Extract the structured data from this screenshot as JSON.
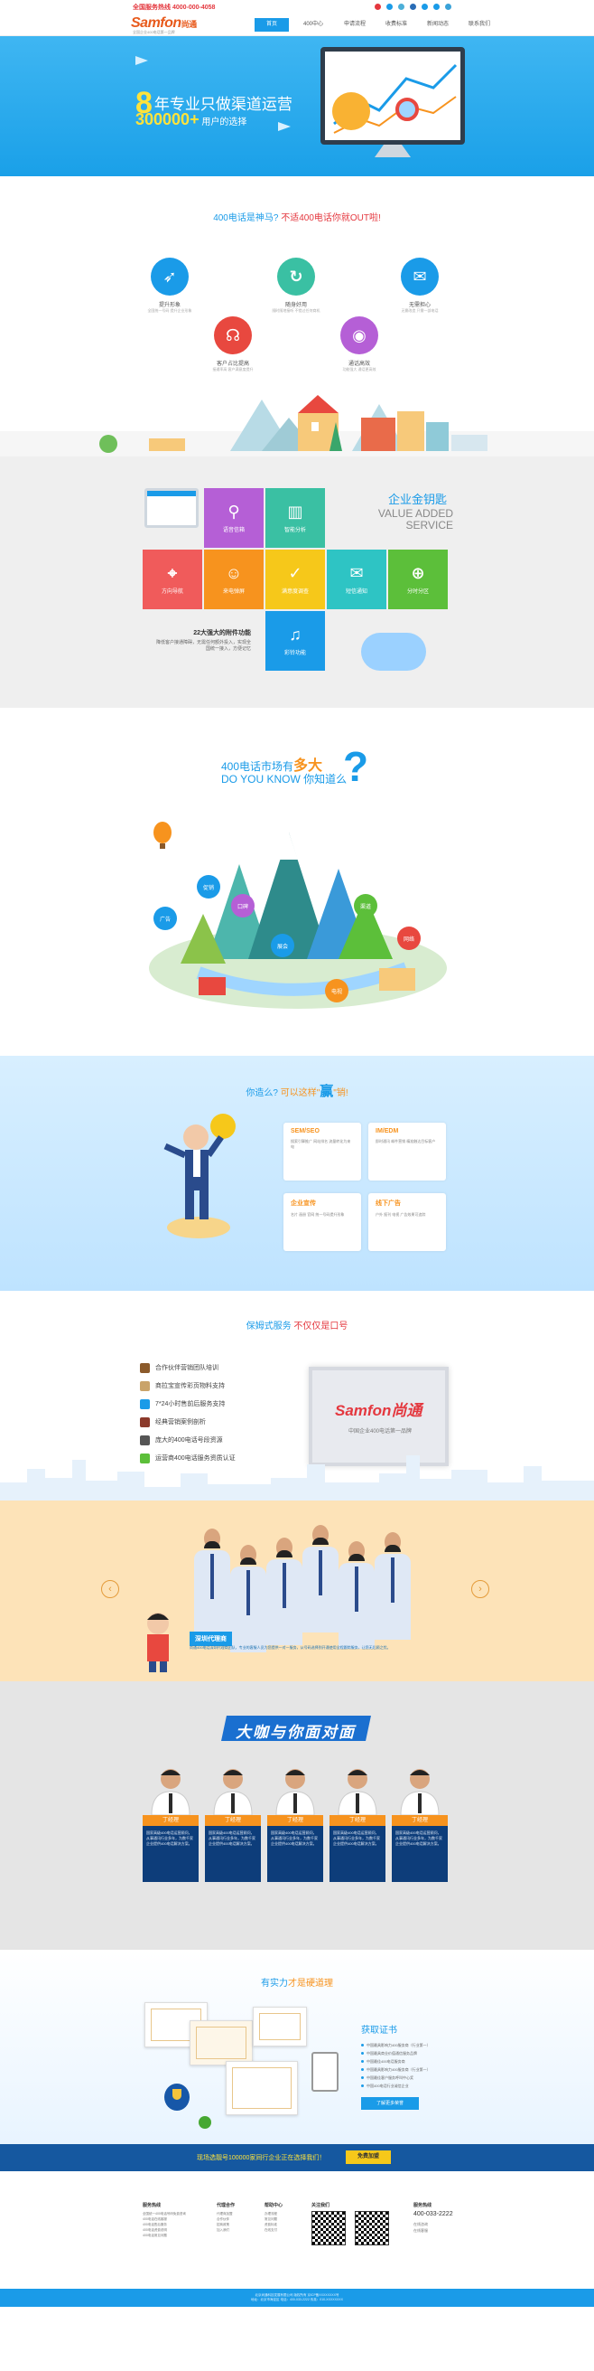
{
  "topbar": {
    "hotline": "全国服务热线 4000-000-4058",
    "logo": "Samfon",
    "logo_cn": "尚通",
    "logo_sub": "全国企业400电话第一品牌",
    "nav": [
      "首页",
      "400中心",
      "申请流程",
      "收费标准",
      "新闻动态",
      "联系我们"
    ]
  },
  "hero": {
    "num": "8",
    "title": "年专业只做渠道运营",
    "count": "300000+",
    "count_suffix": "用户的选择"
  },
  "s400": {
    "title_a": "400电话是神马?",
    "title_b": "不适400电话你就OUT啦!",
    "features": [
      {
        "name": "提升形象",
        "desc": "全国统一号码 提升企业形象"
      },
      {
        "name": "随身好用",
        "desc": "随时随地接听 不错过任何商机"
      },
      {
        "name": "无需担心",
        "desc": "无需改造 只需一部电话"
      },
      {
        "name": "客户占比提高",
        "desc": "接通率高 客户满意度提升"
      },
      {
        "name": "通话高效",
        "desc": "功能强大 通话更高效"
      }
    ]
  },
  "gold": {
    "title": "企业金钥匙",
    "en1": "VALUE ADDED",
    "en2": "SERVICE",
    "left_title": "22大强大的附件功能",
    "left_desc": "降低客户接通障碍，无需任何额外投入，实现全国统一接入，方便记忆",
    "tiles": [
      {
        "label": "语音信箱",
        "icon": "mic-icon",
        "color": "#b55fd6"
      },
      {
        "label": "智能分析",
        "icon": "chart-icon",
        "color": "#3ac0a3"
      },
      {
        "label": "方向导航",
        "icon": "pin-icon",
        "color": "#f05b5b"
      },
      {
        "label": "来电弹屏",
        "icon": "user-icon",
        "color": "#f7931e"
      },
      {
        "label": "满意度调查",
        "icon": "check-icon",
        "color": "#f6c81a"
      },
      {
        "label": "短信通知",
        "icon": "mail-icon",
        "color": "#2ec4c4"
      },
      {
        "label": "分时分区",
        "icon": "globe-icon",
        "color": "#5cbf3a"
      },
      {
        "label": "彩铃功能",
        "icon": "note-icon",
        "color": "#1a9be8"
      }
    ]
  },
  "know": {
    "title_a": "400电话市场有",
    "title_b": "多大",
    "en": "DO YOU KNOW 你知道么",
    "tags": [
      "广告",
      "促销",
      "口碑",
      "展会",
      "渠道",
      "网络",
      "电视"
    ]
  },
  "win": {
    "title_a": "你造么?",
    "title_b": "可以这样\"",
    "title_c": "赢",
    "title_d": "\"销!",
    "cards": [
      {
        "title": "SEM/SEO",
        "desc": "搜索引擎推广 网站排名 流量转化为来电"
      },
      {
        "title": "IM/EDM",
        "desc": "即时通讯 邮件营销 精准触达目标客户"
      },
      {
        "title": "企业宣传",
        "desc": "名片 画册 官网 统一号码提升形象"
      },
      {
        "title": "线下广告",
        "desc": "户外 报刊 电视 广告效果可追踪"
      }
    ]
  },
  "protect": {
    "title_a": "保姆式服务",
    "title_b": "不仅仅是口号",
    "items": [
      "合作伙伴营销团队培训",
      "商拉宝宣传彩页物料支持",
      "7*24小时售前后服务支持",
      "经典营销案例剖析",
      "庞大的400电话号段资源",
      "运营商400电话服务资质认证"
    ],
    "plaque_logo": "Samfon尚通",
    "plaque_text": "中国企业400电话第一品牌"
  },
  "team": {
    "badge": "深圳代理商",
    "desc": "尚通400电话深圳代理商团队，专业的客服人员为您提供一对一服务，从号码选择到开通使用全程跟踪服务，让您无后顾之忧。"
  },
  "big": {
    "banner": "大咖与你面对面",
    "experts": [
      {
        "label": "丁经理",
        "desc": "国家高级400电话运营顾问，从事通讯行业多年，为数千家企业提供400电话解决方案。"
      },
      {
        "label": "丁经理",
        "desc": "国家高级400电话运营顾问，从事通讯行业多年，为数千家企业提供400电话解决方案。"
      },
      {
        "label": "丁经理",
        "desc": "国家高级400电话运营顾问，从事通讯行业多年，为数千家企业提供400电话解决方案。"
      },
      {
        "label": "丁经理",
        "desc": "国家高级400电话运营顾问，从事通讯行业多年，为数千家企业提供400电话解决方案。"
      },
      {
        "label": "丁经理",
        "desc": "国家高级400电话运营顾问，从事通讯行业多年，为数千家企业提供400电话解决方案。"
      }
    ]
  },
  "strength": {
    "title_a": "有实力",
    "title_b": "才是硬道理",
    "cert_title": "获取证书",
    "certs": [
      "中国最具影响力400服务商（行业第一）",
      "中国最具商业价值通信服务品牌",
      "中国最佳400电话服务商",
      "中国最具影响力400服务商（行业第一）",
      "中国最佳客户服务呼叫中心奖",
      "中国400电话行业诚信企业"
    ],
    "cert_btn": "了解更多荣誉"
  },
  "cta": {
    "text": "现场选靓号100000家同行企业正在选择我们！",
    "btn": "免费加盟"
  },
  "footer": {
    "cols": [
      {
        "title": "服务热线",
        "lines": [
          "全国统一400电话号码免费咨询",
          "400电话在线客服",
          "400电话售后服务",
          "400电话资费说明",
          "400电话常见问题"
        ]
      },
      {
        "title": "代理合作",
        "lines": [
          "代理商加盟",
          "合作伙伴",
          "招商政策",
          "加入我们"
        ]
      },
      {
        "title": "帮助中心",
        "lines": [
          "办理流程",
          "常见问题",
          "资费标准",
          "在线支付"
        ]
      },
      {
        "title": "关注我们",
        "lines": [
          "微信公众号",
          "官方微博"
        ]
      }
    ],
    "phone_title": "服务热线",
    "phone": "400-033-2222",
    "phone_lines": [
      "在线咨询",
      "在线客服"
    ],
    "copyright_1": "北京尚通科技发展有限公司 版权所有 京ICP备XXXXXXXX号",
    "copyright_2": "地址：北京市海淀区 电话：400-033-2222 传真：010-XXXXXXXX"
  }
}
